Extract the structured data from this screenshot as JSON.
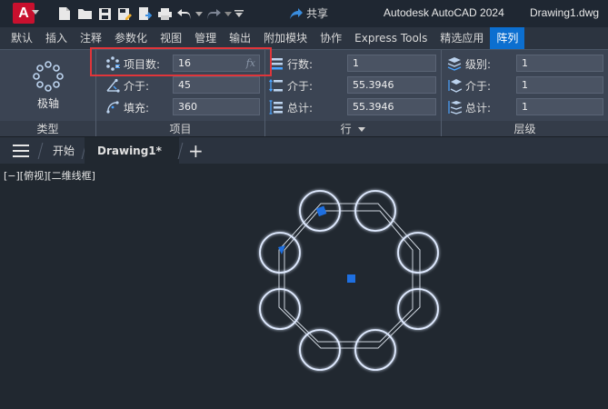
{
  "titlebar": {
    "logo_letter": "A",
    "share_label": "共享",
    "app_name": "Autodesk AutoCAD 2024",
    "document_name": "Drawing1.dwg"
  },
  "ribbon_tabs": [
    "默认",
    "插入",
    "注释",
    "参数化",
    "视图",
    "管理",
    "输出",
    "附加模块",
    "协作",
    "Express Tools",
    "精选应用",
    "阵列"
  ],
  "active_ribbon_tab": "阵列",
  "ribbon": {
    "type_panel": {
      "button_label": "极轴",
      "footer": "类型"
    },
    "items_panel": {
      "footer": "项目",
      "rows": [
        {
          "label": "项目数:",
          "value": "16",
          "icon": "items-count-icon"
        },
        {
          "label": "介于:",
          "value": "45",
          "icon": "angle-between-icon"
        },
        {
          "label": "填充:",
          "value": "360",
          "icon": "fill-angle-icon"
        }
      ],
      "fx_label": "fx"
    },
    "rows_panel": {
      "footer": "行",
      "rows": [
        {
          "label": "行数:",
          "value": "1",
          "icon": "rows-icon"
        },
        {
          "label": "介于:",
          "value": "55.3946",
          "icon": "row-spacing-icon"
        },
        {
          "label": "总计:",
          "value": "55.3946",
          "icon": "row-total-icon"
        }
      ]
    },
    "levels_panel": {
      "footer": "层级",
      "rows": [
        {
          "label": "级别:",
          "value": "1",
          "icon": "levels-icon"
        },
        {
          "label": "介于:",
          "value": "1",
          "icon": "level-spacing-icon"
        },
        {
          "label": "总计:",
          "value": "1",
          "icon": "level-total-icon"
        }
      ]
    }
  },
  "doc_tabs": {
    "start_label": "开始",
    "drawing_label": "Drawing1*",
    "close_glyph": "×",
    "new_glyph": "+"
  },
  "viewport": {
    "label": "[−][俯视][二维线框]"
  },
  "colors": {
    "accent": "#0c6fd0",
    "highlight_box": "#e0353a",
    "grip": "#1e6fe0",
    "circle_glow": "#9fc4ff"
  }
}
